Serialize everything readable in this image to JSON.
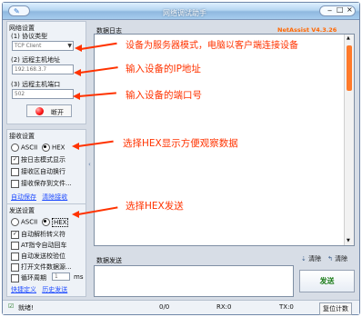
{
  "window": {
    "title": "网络调试助手",
    "brand": "NetAssist V4.3.26"
  },
  "left": {
    "network_settings": "网络设置",
    "protocol_label": "(1) 协议类型",
    "protocol_value": "TCP Client",
    "remote_host_label": "(2) 远程主机地址",
    "remote_host_value": "192.168.3.7",
    "remote_port_label": "(3) 远程主机端口",
    "remote_port_value": "502",
    "disconnect_button": "断开",
    "recv_settings": "接收设置",
    "ascii": "ASCII",
    "hex": "HEX",
    "log_mode": "按日志模式显示",
    "auto_newline": "接收区自动换行",
    "save_to_file": "接收保存到文件...",
    "auto_save": "自动保存",
    "clear_recv": "清除接收",
    "send_settings": "发送设置",
    "auto_escape": "自动解析转义符",
    "at_auto_cr": "AT指令自动回车",
    "auto_checksum": "自动发送校验位",
    "open_file_source": "打开文件数据源...",
    "loop_period": "循环周期",
    "loop_value": "1",
    "loop_unit": "ms",
    "quick_define": "快捷定义",
    "history_send": "历史发送"
  },
  "main": {
    "data_log": "数据日志",
    "data_send": "数据发送",
    "clear_all": "清除",
    "clear": "清除",
    "send_button": "发送"
  },
  "annotations": {
    "n1": "设备为服务器模式，电脑以客户端连接设备",
    "n2": "输入设备的IP地址",
    "n3": "输入设备的端口号",
    "n4": "选择HEX显示方便观察数据",
    "n5": "选择HEX发送"
  },
  "status": {
    "ready": "就绪!",
    "count1": "0/0",
    "rx": "RX:0",
    "tx": "TX:0",
    "reset": "复位计数"
  }
}
